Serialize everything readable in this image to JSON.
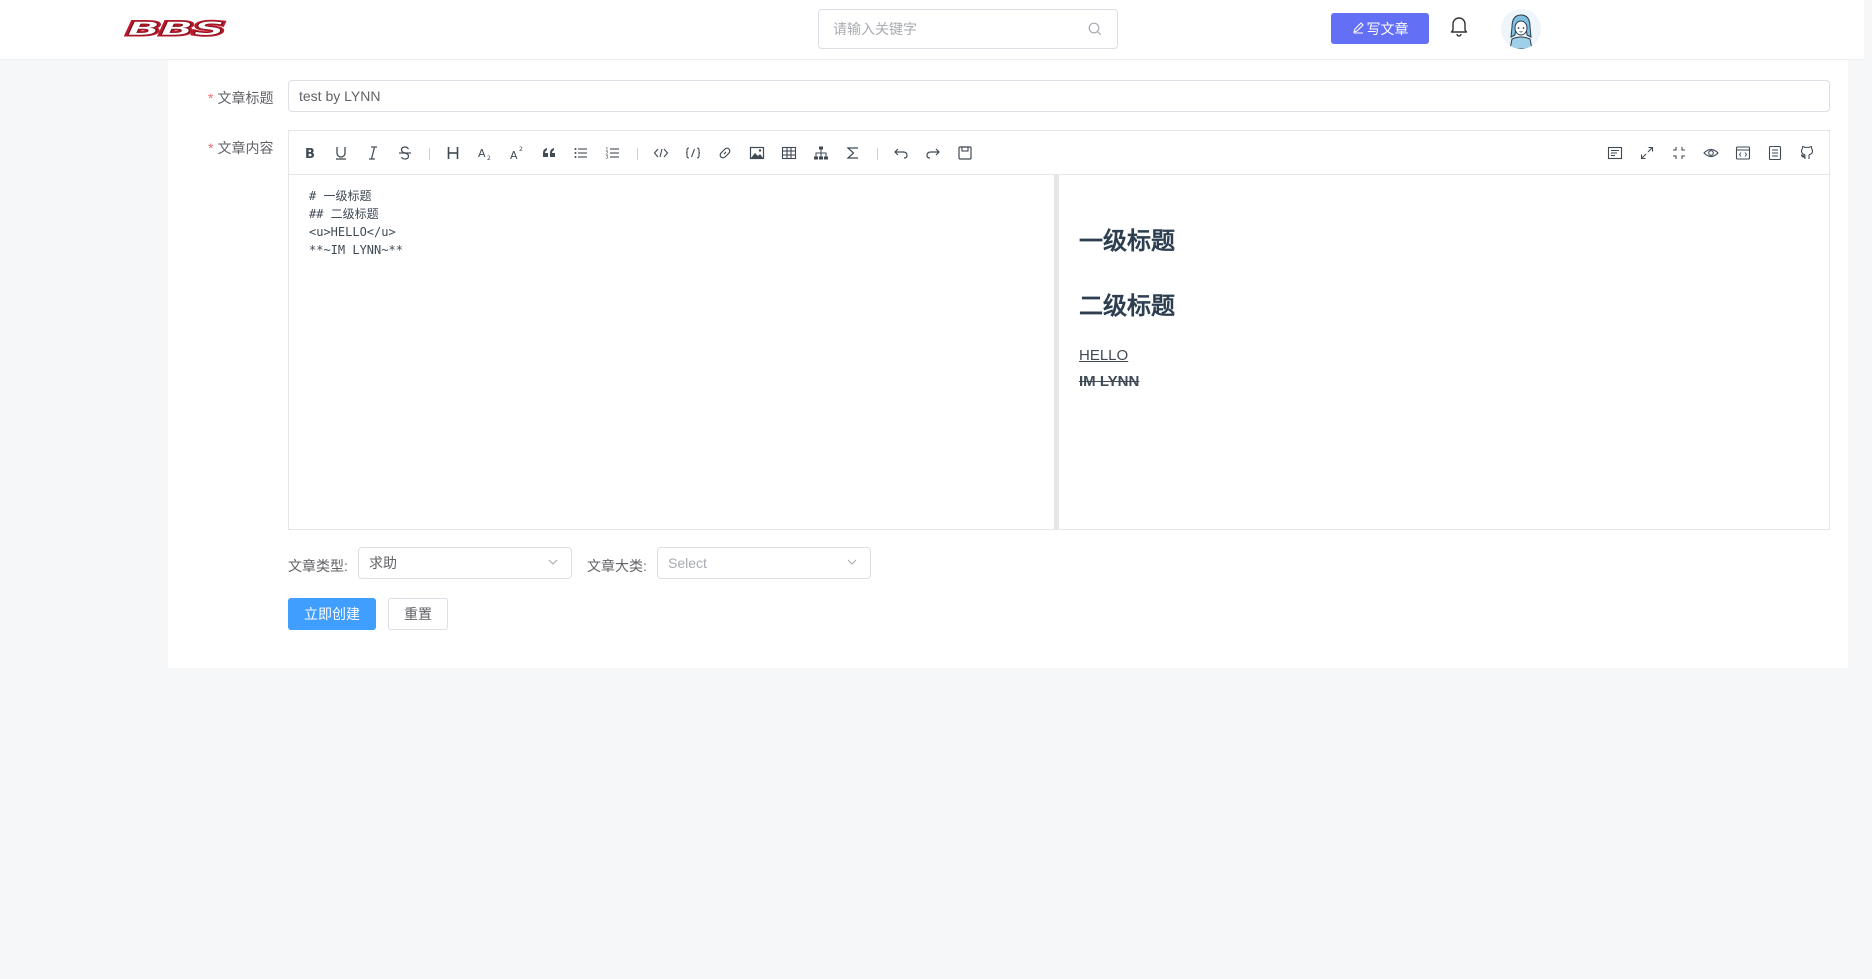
{
  "header": {
    "logo_text": "BBS",
    "search_placeholder": "请输入关键字",
    "write_label": "写文章"
  },
  "form": {
    "title_label": "文章标题",
    "title_value": "test by LYNN",
    "content_label": "文章内容",
    "type_label": "文章类型:",
    "type_value": "求助",
    "category_label": "文章大类:",
    "category_placeholder": "Select",
    "submit_label": "立即创建",
    "reset_label": "重置"
  },
  "editor": {
    "source_text": "# 一级标题\n## 二级标题\n<u>HELLO</u>\n**~IM LYNN~**",
    "preview": {
      "h1": "一级标题",
      "h2": "二级标题",
      "underline": "HELLO",
      "strike": "IM LYNN"
    }
  },
  "icons": {
    "toolbar_left": [
      "bold-icon",
      "underline-icon",
      "italic-icon",
      "strikethrough-icon",
      "heading-icon",
      "subscript-icon",
      "superscript-icon",
      "quote-icon",
      "unordered-list-icon",
      "ordered-list-icon",
      "code-inline-icon",
      "code-block-icon",
      "link-icon",
      "image-icon",
      "table-icon",
      "mermaid-icon",
      "katex-icon",
      "revoke-icon",
      "next-icon",
      "save-icon"
    ],
    "toolbar_right": [
      "catalog-icon",
      "fullscreen-icon",
      "page-fullscreen-icon",
      "preview-icon",
      "html-preview-icon",
      "prettier-icon",
      "github-icon"
    ]
  },
  "colors": {
    "write_button": "#6370f5",
    "primary_button": "#409eff",
    "required_star": "#f56c6c",
    "logo": "#b8192d"
  }
}
